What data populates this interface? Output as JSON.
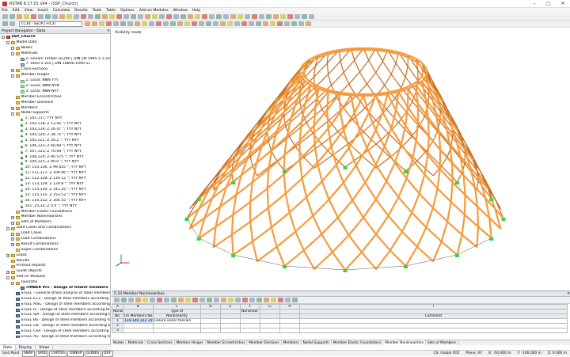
{
  "window": {
    "title": "RSTAB 8.17.01 x64 - [SSP_Church]"
  },
  "menu": [
    "File",
    "Edit",
    "View",
    "Insert",
    "Calculate",
    "Results",
    "Tools",
    "Table",
    "Options",
    "Add-on Modules",
    "Window",
    "Help"
  ],
  "toolbar": {
    "loadcase": "LC30 - sw,IP,(+0.2)"
  },
  "navigator": {
    "title": "Project Navigator - Data",
    "items": [
      {
        "level": 0,
        "exp": "-",
        "icon": "root",
        "label": "SSP_Church",
        "bold": true
      },
      {
        "level": 1,
        "exp": "-",
        "icon": "folder",
        "label": "Model Data"
      },
      {
        "level": 2,
        "exp": "+",
        "icon": "folder",
        "label": "Nodes"
      },
      {
        "level": 2,
        "exp": "-",
        "icon": "folder",
        "label": "Materials"
      },
      {
        "level": 3,
        "exp": "",
        "icon": "mat",
        "label": "2: Glulam Timber GL24h | DIN EN 1995-1-1:2005-"
      },
      {
        "level": 3,
        "exp": "",
        "icon": "mat",
        "label": "7: Steel S 355 | DIN 18800:1990-11"
      },
      {
        "level": 2,
        "exp": "+",
        "icon": "folder",
        "label": "Cross-Sections"
      },
      {
        "level": 2,
        "exp": "-",
        "icon": "folder",
        "label": "Member Hinges"
      },
      {
        "level": 3,
        "exp": "",
        "icon": "file",
        "label": "1: Local; NNN YYY"
      },
      {
        "level": 3,
        "exp": "",
        "icon": "file",
        "label": "2: Local; NNN NYN"
      },
      {
        "level": 3,
        "exp": "",
        "icon": "file",
        "label": "3: Local; NNN NYY"
      },
      {
        "level": 2,
        "exp": "",
        "icon": "folder",
        "label": "Member Eccentricities"
      },
      {
        "level": 2,
        "exp": "",
        "icon": "folder",
        "label": "Member Divisions"
      },
      {
        "level": 2,
        "exp": "+",
        "icon": "folder",
        "label": "Members"
      },
      {
        "level": 2,
        "exp": "-",
        "icon": "folder",
        "label": "Nodal Supports"
      },
      {
        "level": 3,
        "exp": "",
        "icon": "sup",
        "label": "1: 101,117; YYY NYY"
      },
      {
        "level": 3,
        "exp": "",
        "icon": "sup",
        "label": "2: 102,118; Z 13.45 °; YYY NYY"
      },
      {
        "level": 3,
        "exp": "",
        "icon": "sup",
        "label": "3: 103,119; Z 26.47 °; YYY NYY"
      },
      {
        "level": 3,
        "exp": "",
        "icon": "sup",
        "label": "4: 104,120; Z 38.75 °; YYY NYY"
      },
      {
        "level": 3,
        "exp": "",
        "icon": "sup",
        "label": "5: 105,121; Z 50.2 °; YYY NYY"
      },
      {
        "level": 3,
        "exp": "",
        "icon": "sup",
        "label": "6: 106,122; Z 60.68 °; YYY NYY"
      },
      {
        "level": 3,
        "exp": "",
        "icon": "sup",
        "label": "7: 107,123; Z 70.94 °; YYY NYY"
      },
      {
        "level": 3,
        "exp": "",
        "icon": "sup",
        "label": "8: 108,124; Z 80.575 °; YYY NYY"
      },
      {
        "level": 3,
        "exp": "",
        "icon": "sup",
        "label": "9: 109,125; Z 90.0 °; YYY NYY"
      },
      {
        "level": 3,
        "exp": "",
        "icon": "sup",
        "label": "10: 110,126; Z 99.425 °; YYY NYY"
      },
      {
        "level": 3,
        "exp": "",
        "icon": "sup",
        "label": "11: 111,127; Z 109.06 °; YYY NYY"
      },
      {
        "level": 3,
        "exp": "",
        "icon": "sup",
        "label": "12: 112,128; Z 119.12 °; YYY NYY"
      },
      {
        "level": 3,
        "exp": "",
        "icon": "sup",
        "label": "13: 113,129; Z 129.8 °; YYY NYY"
      },
      {
        "level": 3,
        "exp": "",
        "icon": "sup",
        "label": "14: 114,130; Z 141.25 °; YYY NYY"
      },
      {
        "level": 3,
        "exp": "",
        "icon": "sup",
        "label": "15: 115,131; Z 153.53 °; YYY NYY"
      },
      {
        "level": 3,
        "exp": "",
        "icon": "sup",
        "label": "16: 116,132; Z 166.55 °; YYY NYY"
      },
      {
        "level": 3,
        "exp": "",
        "icon": "sup",
        "label": "101: 25,32; Z 0.0 °; YYY NYY"
      },
      {
        "level": 2,
        "exp": "",
        "icon": "folder",
        "label": "Member Elastic Foundations"
      },
      {
        "level": 2,
        "exp": "+",
        "icon": "folder",
        "label": "Member Nonlinearities"
      },
      {
        "level": 2,
        "exp": "+",
        "icon": "folder",
        "label": "Sets of Members"
      },
      {
        "level": 1,
        "exp": "-",
        "icon": "folder",
        "label": "Load Cases and Combinations"
      },
      {
        "level": 2,
        "exp": "+",
        "icon": "folder",
        "label": "Load Cases"
      },
      {
        "level": 2,
        "exp": "+",
        "icon": "folder",
        "label": "Load Combinations"
      },
      {
        "level": 2,
        "exp": "+",
        "icon": "folder",
        "label": "Result Combinations"
      },
      {
        "level": 2,
        "exp": "",
        "icon": "folder",
        "label": "Super Combinations"
      },
      {
        "level": 1,
        "exp": "+",
        "icon": "folder",
        "label": "Loads"
      },
      {
        "level": 1,
        "exp": "",
        "icon": "folder",
        "label": "Results"
      },
      {
        "level": 1,
        "exp": "",
        "icon": "folder",
        "label": "Printout Reports"
      },
      {
        "level": 1,
        "exp": "+",
        "icon": "folder",
        "label": "Guide Objects"
      },
      {
        "level": 1,
        "exp": "-",
        "icon": "folder",
        "label": "Add-on Modules"
      },
      {
        "level": 2,
        "exp": "-",
        "icon": "folder",
        "label": "Favorites"
      },
      {
        "level": 3,
        "exp": "",
        "icon": "mod",
        "label": "TIMBER Pro - Design of timber members",
        "bold": true
      },
      {
        "level": 2,
        "exp": "",
        "icon": "mod",
        "label": "STEEL - General stress analysis of steel members"
      },
      {
        "level": 2,
        "exp": "",
        "icon": "mod",
        "label": "STEEL EC3 - Design of steel members according to E"
      },
      {
        "level": 2,
        "exp": "",
        "icon": "mod",
        "label": "STEEL AISC - Design of steel members according to"
      },
      {
        "level": 2,
        "exp": "",
        "icon": "mod",
        "label": "STEEL IS - Design of steel members according to IS"
      },
      {
        "level": 2,
        "exp": "",
        "icon": "mod",
        "label": "STEEL SIA - Design of steel members according to SI"
      },
      {
        "level": 2,
        "exp": "",
        "icon": "mod",
        "label": "STEEL BS - Design of steel members according to BS"
      },
      {
        "level": 2,
        "exp": "",
        "icon": "mod",
        "label": "STEEL GB - Design of steel members according to GB"
      },
      {
        "level": 2,
        "exp": "",
        "icon": "mod",
        "label": "STEEL CSA - Design of steel members according to C"
      },
      {
        "level": 2,
        "exp": "",
        "icon": "mod",
        "label": "STEEL AS - Design of steel members according to AS"
      }
    ],
    "tabs": [
      "Data",
      "Display",
      "Views"
    ]
  },
  "viewport": {
    "mode_label": "Visibility mode"
  },
  "table_panel": {
    "title": "5.10 Member Nonlinearities",
    "col_letters": [
      "",
      "A",
      "B",
      "C",
      "D",
      "E",
      "F",
      "G",
      "H",
      "I"
    ],
    "head1": [
      "Nonlin.",
      "",
      "Type of",
      "",
      "",
      "Nonlinear Parameters",
      "",
      "",
      ""
    ],
    "head2": [
      "No.",
      "On Members No.",
      "Nonlinearity",
      "",
      "",
      "",
      "",
      "",
      "Comment"
    ],
    "rows": [
      [
        "1",
        "134-140,142-145",
        "Failure under tension",
        "",
        "",
        "",
        "",
        "",
        ""
      ],
      [
        "2",
        "",
        "",
        "",
        "",
        "",
        "",
        "",
        ""
      ],
      [
        "3",
        "",
        "",
        "",
        "",
        "",
        "",
        "",
        ""
      ]
    ],
    "sheet_tabs": [
      "Nodes",
      "Materials",
      "Cross-Sections",
      "Member Hinges",
      "Member Eccentricities",
      "Member Divisions",
      "Members",
      "Nodal Supports",
      "Member Elastic Foundations",
      "Member Nonlinearities",
      "Sets of Members"
    ],
    "active_tab": "Member Nonlinearities"
  },
  "statusbar": {
    "left": "Grid Point",
    "buttons": [
      "SNAP",
      "GRID",
      "CARTES",
      "OSNAP",
      "GLINES",
      "DXF"
    ],
    "cs": "CS: Global XYZ",
    "plane": "Plane: XY",
    "x": "X: -50.000 m",
    "y": "Y: -100.000 m",
    "z": "Z: 0.000 m"
  },
  "colors": {
    "timber": "#f59b3c",
    "timber_dark": "#c96e1e",
    "support": "#3ad23a"
  }
}
